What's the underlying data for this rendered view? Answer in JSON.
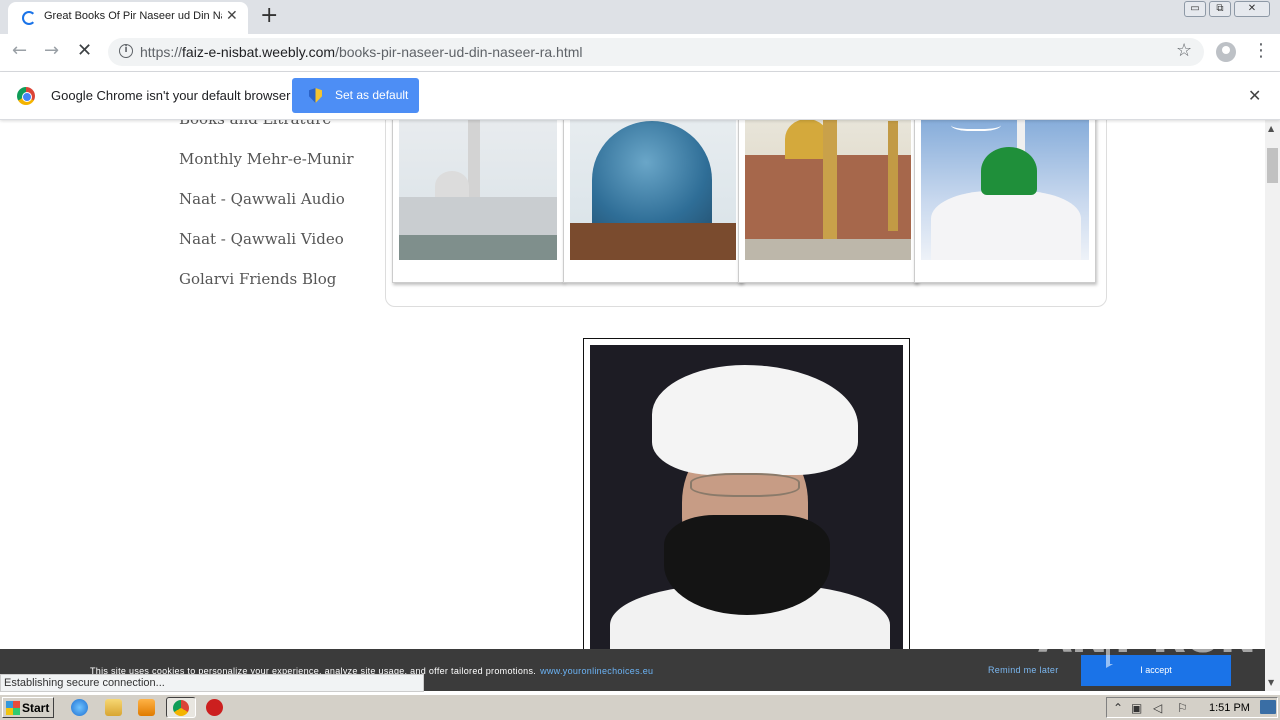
{
  "browser": {
    "tab_title": "Great Books Of Pir Naseer ud Din Na",
    "tab_close": "✕",
    "new_tab": "+",
    "window_buttons": [
      "▭",
      "⧉",
      "✕"
    ],
    "url_prefix": "https://",
    "url_host": "faiz-e-nisbat.weebly.com",
    "url_path": "/books-pir-naseer-ud-din-naseer-ra.html",
    "back_icon": "←",
    "forward_icon": "→",
    "stop_icon": "✕",
    "star_icon": "☆",
    "menu_icon": "⋮"
  },
  "infobar": {
    "message": "Google Chrome isn't your default browser",
    "button_label": "Set as default",
    "close": "✕"
  },
  "sidebar": {
    "items": [
      {
        "label": "Books and Litrature"
      },
      {
        "label": "Monthly Mehr-e-Munir"
      },
      {
        "label": "Naat - Qawwali Audio"
      },
      {
        "label": "Naat - Qawwali Video"
      },
      {
        "label": "Golarvi Friends Blog"
      }
    ]
  },
  "cookie_bar": {
    "text": "This site uses cookies to personalize your experience, analyze site usage, and offer tailored promotions.",
    "link": "www.youronlinechoices.eu",
    "remind_label": "Remind me later",
    "accept_label": "I accept"
  },
  "status": {
    "text": "Establishing secure connection..."
  },
  "watermark": {
    "text": "ANY   RUN"
  },
  "taskbar": {
    "start_label": "Start",
    "clock": "1:51 PM"
  },
  "colors": {
    "accent": "#4d8ef5",
    "cookie_bg": "#3b3b3b",
    "accept_bg": "#1a73e8"
  }
}
